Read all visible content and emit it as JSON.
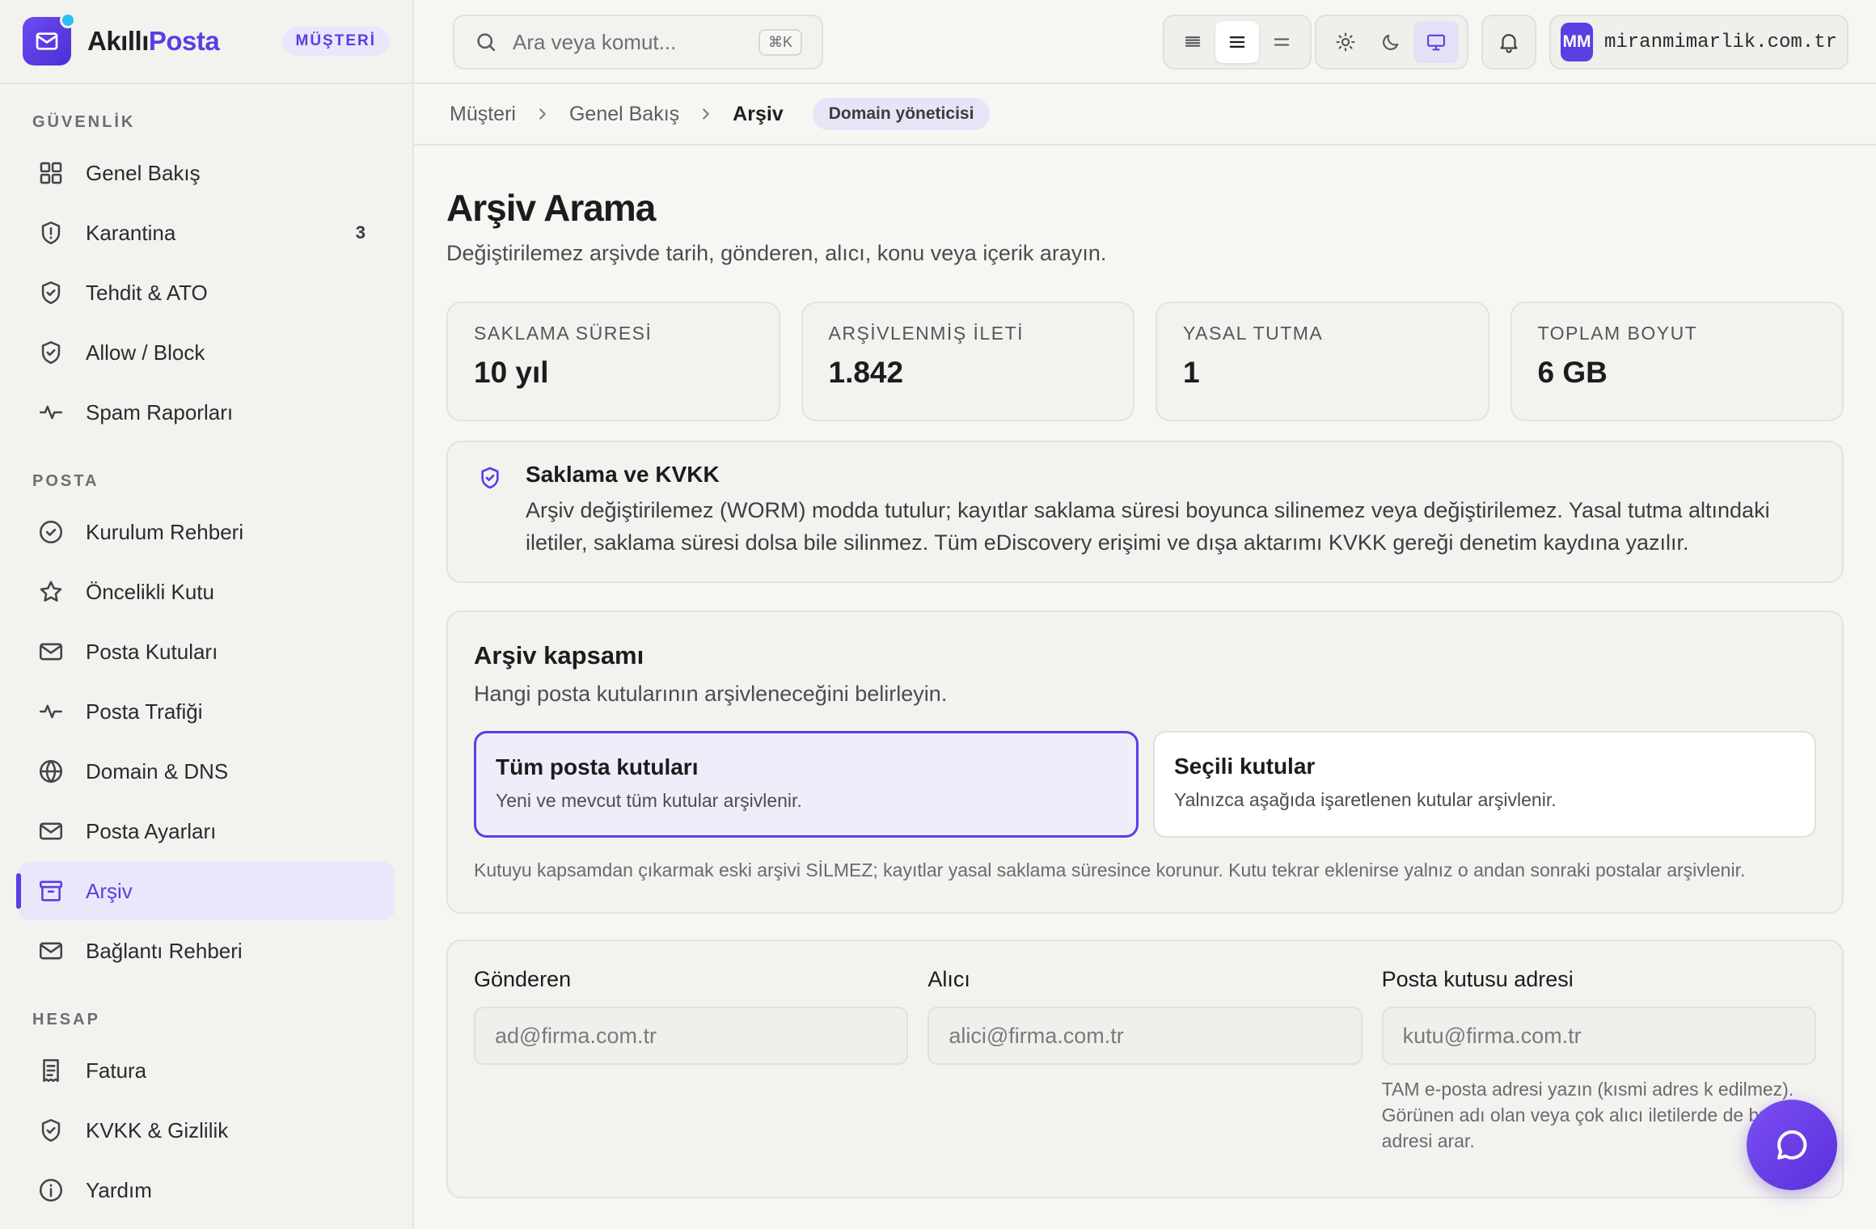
{
  "brand": {
    "name_part1": "Akıllı",
    "name_part2": "Posta",
    "role_badge": "MÜŞTERİ",
    "logo_icon": "mail-icon"
  },
  "sidebar": {
    "sections": [
      {
        "title": "GÜVENLİK",
        "items": [
          {
            "label": "Genel Bakış",
            "icon": "grid-icon"
          },
          {
            "label": "Karantina",
            "icon": "shield-alert-icon",
            "count": "3"
          },
          {
            "label": "Tehdit & ATO",
            "icon": "shield-check-icon"
          },
          {
            "label": "Allow / Block",
            "icon": "shield-check-icon"
          },
          {
            "label": "Spam Raporları",
            "icon": "activity-icon"
          }
        ]
      },
      {
        "title": "POSTA",
        "items": [
          {
            "label": "Kurulum Rehberi",
            "icon": "check-circle-icon"
          },
          {
            "label": "Öncelikli Kutu",
            "icon": "star-icon"
          },
          {
            "label": "Posta Kutuları",
            "icon": "mail-icon"
          },
          {
            "label": "Posta Trafiği",
            "icon": "activity-icon"
          },
          {
            "label": "Domain & DNS",
            "icon": "globe-icon"
          },
          {
            "label": "Posta Ayarları",
            "icon": "mail-icon"
          },
          {
            "label": "Arşiv",
            "icon": "archive-icon",
            "active": true
          },
          {
            "label": "Bağlantı Rehberi",
            "icon": "mail-icon"
          }
        ]
      },
      {
        "title": "HESAP",
        "items": [
          {
            "label": "Fatura",
            "icon": "receipt-icon"
          },
          {
            "label": "KVKK & Gizlilik",
            "icon": "shield-check-icon"
          },
          {
            "label": "Yardım",
            "icon": "info-icon"
          }
        ]
      }
    ]
  },
  "topbar": {
    "search_placeholder": "Ara veya komut...",
    "search_shortcut": "⌘K",
    "density_icons": [
      "density-compact-icon",
      "density-normal-icon",
      "density-loose-icon"
    ],
    "theme_icons": [
      "sun-icon",
      "moon-icon",
      "monitor-icon"
    ],
    "bell_icon": "bell-icon",
    "avatar_initials": "MM",
    "account_domain": "miranmimarlik.com.tr"
  },
  "breadcrumb": {
    "items": [
      "Müşteri",
      "Genel Bakış"
    ],
    "current": "Arşiv",
    "badge": "Domain yöneticisi"
  },
  "page": {
    "title": "Arşiv Arama",
    "subtitle": "Değiştirilemez arşivde tarih, gönderen, alıcı, konu veya içerik arayın."
  },
  "stats": [
    {
      "label": "SAKLAMA SÜRESİ",
      "value": "10 yıl"
    },
    {
      "label": "ARŞİVLENMİŞ İLETİ",
      "value": "1.842"
    },
    {
      "label": "YASAL TUTMA",
      "value": "1"
    },
    {
      "label": "TOPLAM BOYUT",
      "value": "6 GB"
    }
  ],
  "notice": {
    "title": "Saklama ve KVKK",
    "text": "Arşiv değiştirilemez (WORM) modda tutulur; kayıtlar saklama süresi boyunca silinemez veya değiştirilemez. Yasal tutma altındaki iletiler, saklama süresi dolsa bile silinmez. Tüm eDiscovery erişimi ve dışa aktarımı KVKK gereği denetim kaydına yazılır."
  },
  "scope": {
    "title": "Arşiv kapsamı",
    "subtitle": "Hangi posta kutularının arşivleneceğini belirleyin.",
    "options": [
      {
        "title": "Tüm posta kutuları",
        "desc": "Yeni ve mevcut tüm kutular arşivlenir.",
        "selected": true
      },
      {
        "title": "Seçili kutular",
        "desc": "Yalnızca aşağıda işaretlenen kutular arşivlenir.",
        "selected": false
      }
    ],
    "note": "Kutuyu kapsamdan çıkarmak eski arşivi SİLMEZ; kayıtlar yasal saklama süresince korunur. Kutu tekrar eklenirse yalnız o andan sonraki postalar arşivlenir."
  },
  "filters": {
    "sender": {
      "label": "Gönderen",
      "placeholder": "ad@firma.com.tr"
    },
    "recipient": {
      "label": "Alıcı",
      "placeholder": "alici@firma.com.tr"
    },
    "mailbox": {
      "label": "Posta kutusu adresi",
      "placeholder": "kutu@firma.com.tr",
      "help": "TAM e-posta adresi yazın (kısmi adres k edilmez). Görünen adı olan veya çok alıcı iletilerde de bu adresi arar."
    }
  },
  "chat": {
    "icon": "chat-bubble-icon"
  },
  "colors": {
    "accent": "#5b3ee4",
    "background": "#f7f6f3",
    "sidebar": "#f3f2ef"
  }
}
